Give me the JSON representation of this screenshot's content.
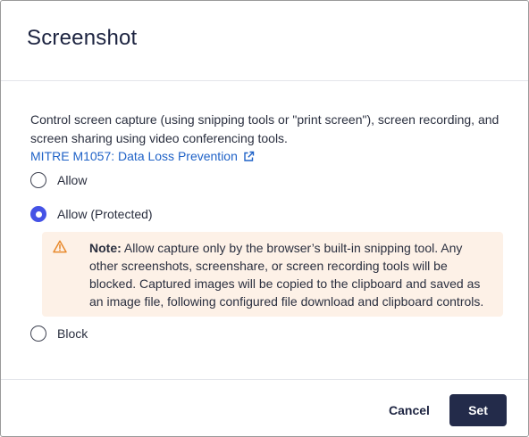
{
  "dialog": {
    "title": "Screenshot",
    "description": "Control screen capture (using snipping tools or \"print screen\"), screen recording, and screen sharing using video conferencing tools.",
    "reference_link": "MITRE M1057: Data Loss Prevention",
    "options": [
      {
        "label": "Allow",
        "selected": false
      },
      {
        "label": "Allow (Protected)",
        "selected": true
      },
      {
        "label": "Block",
        "selected": false
      }
    ],
    "note": {
      "prefix": "Note:",
      "text": " Allow capture only by the browser’s built-in snipping tool. Any other screenshots, screenshare, or screen recording tools will be blocked. Captured images will be copied to the clipboard and saved as an image file, following configured file download and clipboard controls."
    },
    "buttons": {
      "cancel": "Cancel",
      "set": "Set"
    }
  },
  "colors": {
    "accent": "#4553e6",
    "primary_button": "#232b4a",
    "link": "#1f62c7",
    "note_background": "#fdf1e7",
    "warning_icon": "#e8892c"
  }
}
